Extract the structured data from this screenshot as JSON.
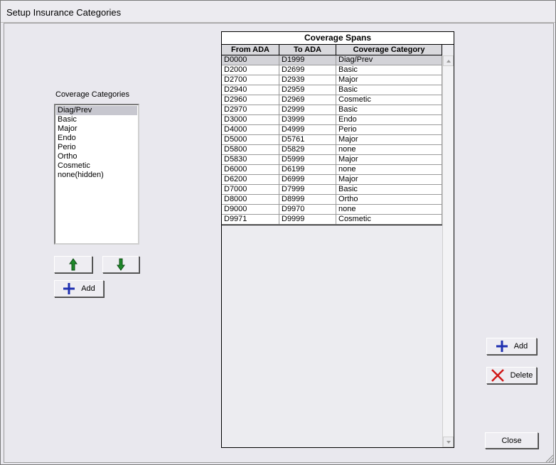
{
  "window": {
    "title": "Setup Insurance Categories"
  },
  "categories": {
    "label": "Coverage Categories",
    "items": [
      "Diag/Prev",
      "Basic",
      "Major",
      "Endo",
      "Perio",
      "Ortho",
      "Cosmetic",
      "none(hidden)"
    ],
    "selected_index": 0
  },
  "left_buttons": {
    "add_label": "Add"
  },
  "grid": {
    "title": "Coverage Spans",
    "columns": [
      "From ADA",
      "To ADA",
      "Coverage Category"
    ],
    "rows": [
      [
        "D0000",
        "D1999",
        "Diag/Prev"
      ],
      [
        "D2000",
        "D2699",
        "Basic"
      ],
      [
        "D2700",
        "D2939",
        "Major"
      ],
      [
        "D2940",
        "D2959",
        "Basic"
      ],
      [
        "D2960",
        "D2969",
        "Cosmetic"
      ],
      [
        "D2970",
        "D2999",
        "Basic"
      ],
      [
        "D3000",
        "D3999",
        "Endo"
      ],
      [
        "D4000",
        "D4999",
        "Perio"
      ],
      [
        "D5000",
        "D5761",
        "Major"
      ],
      [
        "D5800",
        "D5829",
        "none"
      ],
      [
        "D5830",
        "D5999",
        "Major"
      ],
      [
        "D6000",
        "D6199",
        "none"
      ],
      [
        "D6200",
        "D6999",
        "Major"
      ],
      [
        "D7000",
        "D7999",
        "Basic"
      ],
      [
        "D8000",
        "D8999",
        "Ortho"
      ],
      [
        "D9000",
        "D9970",
        "none"
      ],
      [
        "D9971",
        "D9999",
        "Cosmetic"
      ]
    ],
    "selected_row": 0
  },
  "right_buttons": {
    "add_label": "Add",
    "delete_label": "Delete",
    "close_label": "Close"
  },
  "colors": {
    "plus_icon": "#1e2fb0",
    "delete_icon": "#d01818",
    "arrow_icon": "#1f8a2a"
  }
}
